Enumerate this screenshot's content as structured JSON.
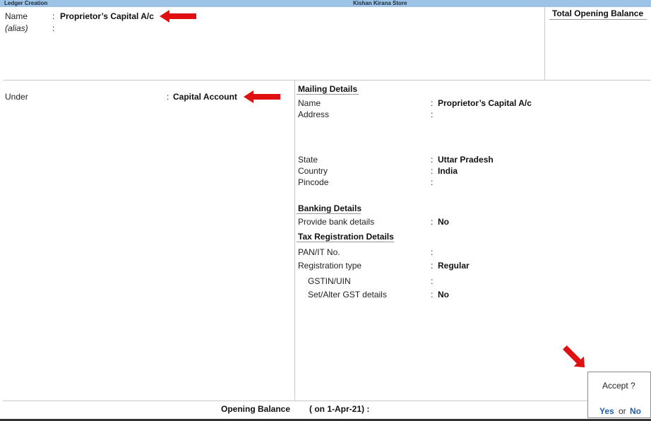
{
  "titlebar": {
    "left": "Ledger Creation",
    "center": "Kishan Kirana Store"
  },
  "header": {
    "name_label": "Name",
    "name_value": "Proprietor’s Capital A/c",
    "alias_label": "(alias)",
    "colon": ":",
    "total_opening_balance": "Total Opening Balance"
  },
  "left": {
    "under_label": "Under",
    "under_value": "Capital Account"
  },
  "mailing": {
    "heading": "Mailing Details",
    "name_label": "Name",
    "name_value": "Proprietor’s Capital A/c",
    "address_label": "Address",
    "state_label": "State",
    "state_value": "Uttar Pradesh",
    "country_label": "Country",
    "country_value": "India",
    "pincode_label": "Pincode"
  },
  "banking": {
    "heading": "Banking Details",
    "provide_label": "Provide bank details",
    "provide_value": "No"
  },
  "tax": {
    "heading": "Tax Registration Details",
    "pan_label": "PAN/IT No.",
    "regtype_label": "Registration type",
    "regtype_value": "Regular",
    "gstin_label": "GSTIN/UIN",
    "setalter_label": "Set/Alter GST details",
    "setalter_value": "No"
  },
  "footer": {
    "opening_balance_label": "Opening Balance",
    "opening_balance_date": "( on 1-Apr-21)  :"
  },
  "accept": {
    "question": "Accept ?",
    "yes": "Yes",
    "or": "or",
    "no": "No"
  },
  "colors": {
    "titlebar": "#9dc3e6",
    "arrow": "#e01010",
    "link": "#1f5fa8"
  }
}
